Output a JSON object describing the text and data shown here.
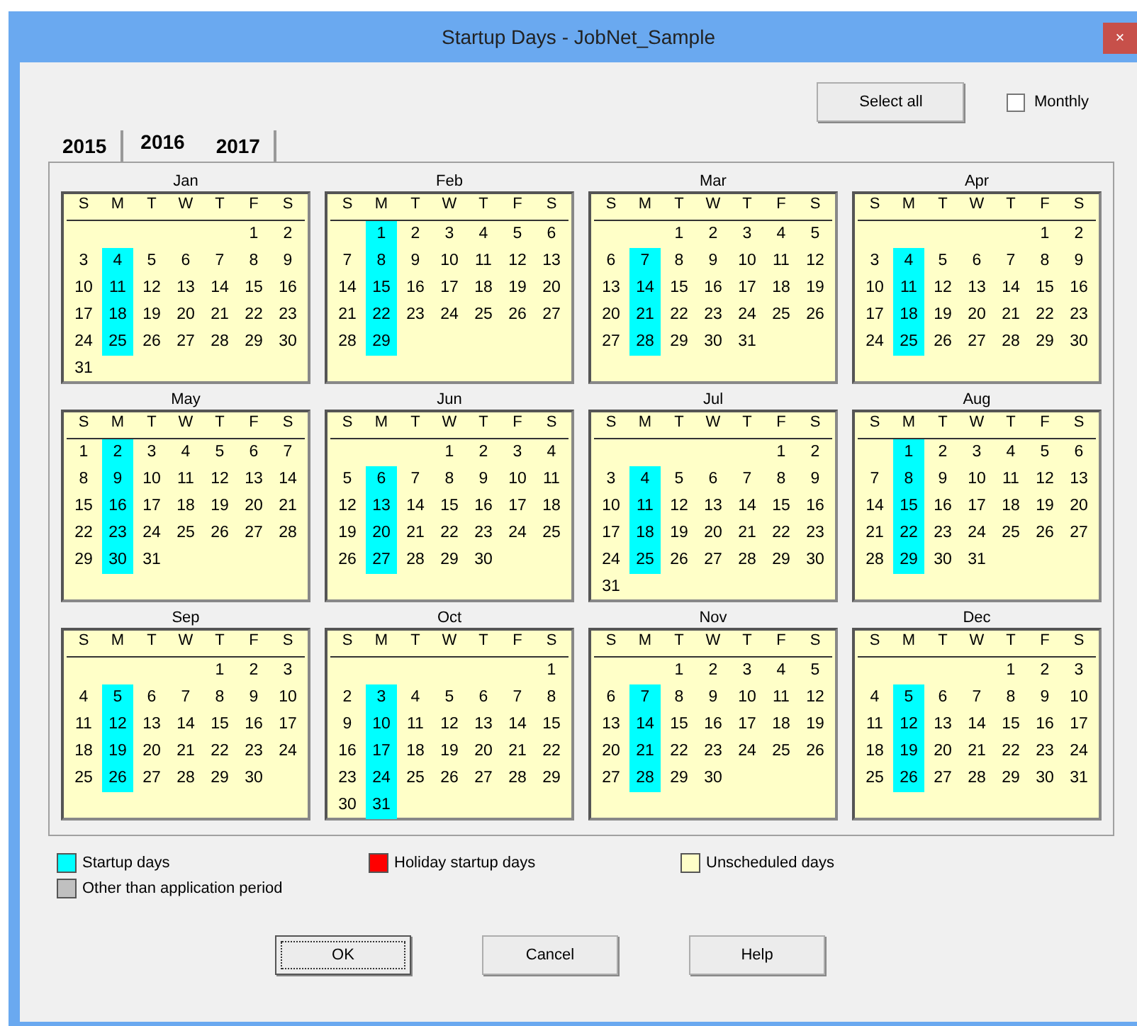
{
  "window": {
    "title": "Startup Days - JobNet_Sample",
    "close": "×"
  },
  "select_all": "Select all",
  "monthly": {
    "label": "Monthly",
    "checked": false
  },
  "tabs": [
    {
      "label": "2015",
      "selected": false
    },
    {
      "label": "2016",
      "selected": true
    },
    {
      "label": "2017",
      "selected": false
    }
  ],
  "months": [
    {
      "name": "Jan",
      "weekdays": [
        "S",
        "M",
        "T",
        "W",
        "T",
        "F",
        "S"
      ],
      "weeks": [
        [
          {
            "d": "1",
            "s": false
          },
          {
            "d": "2",
            "s": false
          }
        ],
        [
          {
            "d": "3",
            "s": false
          },
          {
            "d": "4",
            "s": true
          },
          {
            "d": "5",
            "s": false
          },
          {
            "d": "6",
            "s": false
          },
          {
            "d": "7",
            "s": false
          },
          {
            "d": "8",
            "s": false
          },
          {
            "d": "9",
            "s": false
          }
        ],
        [
          {
            "d": "10",
            "s": false
          },
          {
            "d": "11",
            "s": true
          },
          {
            "d": "12",
            "s": false
          },
          {
            "d": "13",
            "s": false
          },
          {
            "d": "14",
            "s": false
          },
          {
            "d": "15",
            "s": false
          },
          {
            "d": "16",
            "s": false
          }
        ],
        [
          {
            "d": "17",
            "s": false
          },
          {
            "d": "18",
            "s": true
          },
          {
            "d": "19",
            "s": false
          },
          {
            "d": "20",
            "s": false
          },
          {
            "d": "21",
            "s": false
          },
          {
            "d": "22",
            "s": false
          },
          {
            "d": "23",
            "s": false
          }
        ],
        [
          {
            "d": "24",
            "s": false
          },
          {
            "d": "25",
            "s": true
          },
          {
            "d": "26",
            "s": false
          },
          {
            "d": "27",
            "s": false
          },
          {
            "d": "28",
            "s": false
          },
          {
            "d": "29",
            "s": false
          },
          {
            "d": "30",
            "s": false
          }
        ],
        [
          {
            "d": "31",
            "s": false
          }
        ]
      ]
    },
    {
      "name": "Feb",
      "weekdays": [
        "S",
        "M",
        "T",
        "W",
        "T",
        "F",
        "S"
      ],
      "weeks": [
        [
          {
            "d": "1",
            "s": true
          },
          {
            "d": "2",
            "s": false
          },
          {
            "d": "3",
            "s": false
          },
          {
            "d": "4",
            "s": false
          },
          {
            "d": "5",
            "s": false
          },
          {
            "d": "6",
            "s": false
          }
        ],
        [
          {
            "d": "7",
            "s": false
          },
          {
            "d": "8",
            "s": true
          },
          {
            "d": "9",
            "s": false
          },
          {
            "d": "10",
            "s": false
          },
          {
            "d": "11",
            "s": false
          },
          {
            "d": "12",
            "s": false
          },
          {
            "d": "13",
            "s": false
          }
        ],
        [
          {
            "d": "14",
            "s": false
          },
          {
            "d": "15",
            "s": true
          },
          {
            "d": "16",
            "s": false
          },
          {
            "d": "17",
            "s": false
          },
          {
            "d": "18",
            "s": false
          },
          {
            "d": "19",
            "s": false
          },
          {
            "d": "20",
            "s": false
          }
        ],
        [
          {
            "d": "21",
            "s": false
          },
          {
            "d": "22",
            "s": true
          },
          {
            "d": "23",
            "s": false
          },
          {
            "d": "24",
            "s": false
          },
          {
            "d": "25",
            "s": false
          },
          {
            "d": "26",
            "s": false
          },
          {
            "d": "27",
            "s": false
          }
        ],
        [
          {
            "d": "28",
            "s": false
          },
          {
            "d": "29",
            "s": true
          }
        ]
      ]
    },
    {
      "name": "Mar",
      "weekdays": [
        "S",
        "M",
        "T",
        "W",
        "T",
        "F",
        "S"
      ],
      "weeks": [
        [
          {
            "d": "1",
            "s": false
          },
          {
            "d": "2",
            "s": false
          },
          {
            "d": "3",
            "s": false
          },
          {
            "d": "4",
            "s": false
          },
          {
            "d": "5",
            "s": false
          }
        ],
        [
          {
            "d": "6",
            "s": false
          },
          {
            "d": "7",
            "s": true
          },
          {
            "d": "8",
            "s": false
          },
          {
            "d": "9",
            "s": false
          },
          {
            "d": "10",
            "s": false
          },
          {
            "d": "11",
            "s": false
          },
          {
            "d": "12",
            "s": false
          }
        ],
        [
          {
            "d": "13",
            "s": false
          },
          {
            "d": "14",
            "s": true
          },
          {
            "d": "15",
            "s": false
          },
          {
            "d": "16",
            "s": false
          },
          {
            "d": "17",
            "s": false
          },
          {
            "d": "18",
            "s": false
          },
          {
            "d": "19",
            "s": false
          }
        ],
        [
          {
            "d": "20",
            "s": false
          },
          {
            "d": "21",
            "s": true
          },
          {
            "d": "22",
            "s": false
          },
          {
            "d": "23",
            "s": false
          },
          {
            "d": "24",
            "s": false
          },
          {
            "d": "25",
            "s": false
          },
          {
            "d": "26",
            "s": false
          }
        ],
        [
          {
            "d": "27",
            "s": false
          },
          {
            "d": "28",
            "s": true
          },
          {
            "d": "29",
            "s": false
          },
          {
            "d": "30",
            "s": false
          },
          {
            "d": "31",
            "s": false
          }
        ]
      ]
    },
    {
      "name": "Apr",
      "weekdays": [
        "S",
        "M",
        "T",
        "W",
        "T",
        "F",
        "S"
      ],
      "weeks": [
        [
          {
            "d": "1",
            "s": false
          },
          {
            "d": "2",
            "s": false
          }
        ],
        [
          {
            "d": "3",
            "s": false
          },
          {
            "d": "4",
            "s": true
          },
          {
            "d": "5",
            "s": false
          },
          {
            "d": "6",
            "s": false
          },
          {
            "d": "7",
            "s": false
          },
          {
            "d": "8",
            "s": false
          },
          {
            "d": "9",
            "s": false
          }
        ],
        [
          {
            "d": "10",
            "s": false
          },
          {
            "d": "11",
            "s": true
          },
          {
            "d": "12",
            "s": false
          },
          {
            "d": "13",
            "s": false
          },
          {
            "d": "14",
            "s": false
          },
          {
            "d": "15",
            "s": false
          },
          {
            "d": "16",
            "s": false
          }
        ],
        [
          {
            "d": "17",
            "s": false
          },
          {
            "d": "18",
            "s": true
          },
          {
            "d": "19",
            "s": false
          },
          {
            "d": "20",
            "s": false
          },
          {
            "d": "21",
            "s": false
          },
          {
            "d": "22",
            "s": false
          },
          {
            "d": "23",
            "s": false
          }
        ],
        [
          {
            "d": "24",
            "s": false
          },
          {
            "d": "25",
            "s": true
          },
          {
            "d": "26",
            "s": false
          },
          {
            "d": "27",
            "s": false
          },
          {
            "d": "28",
            "s": false
          },
          {
            "d": "29",
            "s": false
          },
          {
            "d": "30",
            "s": false
          }
        ]
      ]
    },
    {
      "name": "May",
      "weekdays": [
        "S",
        "M",
        "T",
        "W",
        "T",
        "F",
        "S"
      ],
      "weeks": [
        [
          {
            "d": "1",
            "s": false
          },
          {
            "d": "2",
            "s": true
          },
          {
            "d": "3",
            "s": false
          },
          {
            "d": "4",
            "s": false
          },
          {
            "d": "5",
            "s": false
          },
          {
            "d": "6",
            "s": false
          },
          {
            "d": "7",
            "s": false
          }
        ],
        [
          {
            "d": "8",
            "s": false
          },
          {
            "d": "9",
            "s": true
          },
          {
            "d": "10",
            "s": false
          },
          {
            "d": "11",
            "s": false
          },
          {
            "d": "12",
            "s": false
          },
          {
            "d": "13",
            "s": false
          },
          {
            "d": "14",
            "s": false
          }
        ],
        [
          {
            "d": "15",
            "s": false
          },
          {
            "d": "16",
            "s": true
          },
          {
            "d": "17",
            "s": false
          },
          {
            "d": "18",
            "s": false
          },
          {
            "d": "19",
            "s": false
          },
          {
            "d": "20",
            "s": false
          },
          {
            "d": "21",
            "s": false
          }
        ],
        [
          {
            "d": "22",
            "s": false
          },
          {
            "d": "23",
            "s": true
          },
          {
            "d": "24",
            "s": false
          },
          {
            "d": "25",
            "s": false
          },
          {
            "d": "26",
            "s": false
          },
          {
            "d": "27",
            "s": false
          },
          {
            "d": "28",
            "s": false
          }
        ],
        [
          {
            "d": "29",
            "s": false
          },
          {
            "d": "30",
            "s": true
          },
          {
            "d": "31",
            "s": false
          }
        ]
      ]
    },
    {
      "name": "Jun",
      "weekdays": [
        "S",
        "M",
        "T",
        "W",
        "T",
        "F",
        "S"
      ],
      "weeks": [
        [
          {
            "d": "1",
            "s": false
          },
          {
            "d": "2",
            "s": false
          },
          {
            "d": "3",
            "s": false
          },
          {
            "d": "4",
            "s": false
          }
        ],
        [
          {
            "d": "5",
            "s": false
          },
          {
            "d": "6",
            "s": true
          },
          {
            "d": "7",
            "s": false
          },
          {
            "d": "8",
            "s": false
          },
          {
            "d": "9",
            "s": false
          },
          {
            "d": "10",
            "s": false
          },
          {
            "d": "11",
            "s": false
          }
        ],
        [
          {
            "d": "12",
            "s": false
          },
          {
            "d": "13",
            "s": true
          },
          {
            "d": "14",
            "s": false
          },
          {
            "d": "15",
            "s": false
          },
          {
            "d": "16",
            "s": false
          },
          {
            "d": "17",
            "s": false
          },
          {
            "d": "18",
            "s": false
          }
        ],
        [
          {
            "d": "19",
            "s": false
          },
          {
            "d": "20",
            "s": true
          },
          {
            "d": "21",
            "s": false
          },
          {
            "d": "22",
            "s": false
          },
          {
            "d": "23",
            "s": false
          },
          {
            "d": "24",
            "s": false
          },
          {
            "d": "25",
            "s": false
          }
        ],
        [
          {
            "d": "26",
            "s": false
          },
          {
            "d": "27",
            "s": true
          },
          {
            "d": "28",
            "s": false
          },
          {
            "d": "29",
            "s": false
          },
          {
            "d": "30",
            "s": false
          }
        ]
      ]
    },
    {
      "name": "Jul",
      "weekdays": [
        "S",
        "M",
        "T",
        "W",
        "T",
        "F",
        "S"
      ],
      "weeks": [
        [
          {
            "d": "1",
            "s": false
          },
          {
            "d": "2",
            "s": false
          }
        ],
        [
          {
            "d": "3",
            "s": false
          },
          {
            "d": "4",
            "s": true
          },
          {
            "d": "5",
            "s": false
          },
          {
            "d": "6",
            "s": false
          },
          {
            "d": "7",
            "s": false
          },
          {
            "d": "8",
            "s": false
          },
          {
            "d": "9",
            "s": false
          }
        ],
        [
          {
            "d": "10",
            "s": false
          },
          {
            "d": "11",
            "s": true
          },
          {
            "d": "12",
            "s": false
          },
          {
            "d": "13",
            "s": false
          },
          {
            "d": "14",
            "s": false
          },
          {
            "d": "15",
            "s": false
          },
          {
            "d": "16",
            "s": false
          }
        ],
        [
          {
            "d": "17",
            "s": false
          },
          {
            "d": "18",
            "s": true
          },
          {
            "d": "19",
            "s": false
          },
          {
            "d": "20",
            "s": false
          },
          {
            "d": "21",
            "s": false
          },
          {
            "d": "22",
            "s": false
          },
          {
            "d": "23",
            "s": false
          }
        ],
        [
          {
            "d": "24",
            "s": false
          },
          {
            "d": "25",
            "s": true
          },
          {
            "d": "26",
            "s": false
          },
          {
            "d": "27",
            "s": false
          },
          {
            "d": "28",
            "s": false
          },
          {
            "d": "29",
            "s": false
          },
          {
            "d": "30",
            "s": false
          }
        ],
        [
          {
            "d": "31",
            "s": false
          }
        ]
      ]
    },
    {
      "name": "Aug",
      "weekdays": [
        "S",
        "M",
        "T",
        "W",
        "T",
        "F",
        "S"
      ],
      "weeks": [
        [
          {
            "d": "1",
            "s": true
          },
          {
            "d": "2",
            "s": false
          },
          {
            "d": "3",
            "s": false
          },
          {
            "d": "4",
            "s": false
          },
          {
            "d": "5",
            "s": false
          },
          {
            "d": "6",
            "s": false
          }
        ],
        [
          {
            "d": "7",
            "s": false
          },
          {
            "d": "8",
            "s": true
          },
          {
            "d": "9",
            "s": false
          },
          {
            "d": "10",
            "s": false
          },
          {
            "d": "11",
            "s": false
          },
          {
            "d": "12",
            "s": false
          },
          {
            "d": "13",
            "s": false
          }
        ],
        [
          {
            "d": "14",
            "s": false
          },
          {
            "d": "15",
            "s": true
          },
          {
            "d": "16",
            "s": false
          },
          {
            "d": "17",
            "s": false
          },
          {
            "d": "18",
            "s": false
          },
          {
            "d": "19",
            "s": false
          },
          {
            "d": "20",
            "s": false
          }
        ],
        [
          {
            "d": "21",
            "s": false
          },
          {
            "d": "22",
            "s": true
          },
          {
            "d": "23",
            "s": false
          },
          {
            "d": "24",
            "s": false
          },
          {
            "d": "25",
            "s": false
          },
          {
            "d": "26",
            "s": false
          },
          {
            "d": "27",
            "s": false
          }
        ],
        [
          {
            "d": "28",
            "s": false
          },
          {
            "d": "29",
            "s": true
          },
          {
            "d": "30",
            "s": false
          },
          {
            "d": "31",
            "s": false
          }
        ]
      ]
    },
    {
      "name": "Sep",
      "weekdays": [
        "S",
        "M",
        "T",
        "W",
        "T",
        "F",
        "S"
      ],
      "weeks": [
        [
          {
            "d": "1",
            "s": false
          },
          {
            "d": "2",
            "s": false
          },
          {
            "d": "3",
            "s": false
          }
        ],
        [
          {
            "d": "4",
            "s": false
          },
          {
            "d": "5",
            "s": true
          },
          {
            "d": "6",
            "s": false
          },
          {
            "d": "7",
            "s": false
          },
          {
            "d": "8",
            "s": false
          },
          {
            "d": "9",
            "s": false
          },
          {
            "d": "10",
            "s": false
          }
        ],
        [
          {
            "d": "11",
            "s": false
          },
          {
            "d": "12",
            "s": true
          },
          {
            "d": "13",
            "s": false
          },
          {
            "d": "14",
            "s": false
          },
          {
            "d": "15",
            "s": false
          },
          {
            "d": "16",
            "s": false
          },
          {
            "d": "17",
            "s": false
          }
        ],
        [
          {
            "d": "18",
            "s": false
          },
          {
            "d": "19",
            "s": true
          },
          {
            "d": "20",
            "s": false
          },
          {
            "d": "21",
            "s": false
          },
          {
            "d": "22",
            "s": false
          },
          {
            "d": "23",
            "s": false
          },
          {
            "d": "24",
            "s": false
          }
        ],
        [
          {
            "d": "25",
            "s": false
          },
          {
            "d": "26",
            "s": true
          },
          {
            "d": "27",
            "s": false
          },
          {
            "d": "28",
            "s": false
          },
          {
            "d": "29",
            "s": false
          },
          {
            "d": "30",
            "s": false
          }
        ]
      ]
    },
    {
      "name": "Oct",
      "weekdays": [
        "S",
        "M",
        "T",
        "W",
        "T",
        "F",
        "S"
      ],
      "weeks": [
        [
          {
            "d": "1",
            "s": false
          }
        ],
        [
          {
            "d": "2",
            "s": false
          },
          {
            "d": "3",
            "s": true
          },
          {
            "d": "4",
            "s": false
          },
          {
            "d": "5",
            "s": false
          },
          {
            "d": "6",
            "s": false
          },
          {
            "d": "7",
            "s": false
          },
          {
            "d": "8",
            "s": false
          }
        ],
        [
          {
            "d": "9",
            "s": false
          },
          {
            "d": "10",
            "s": true
          },
          {
            "d": "11",
            "s": false
          },
          {
            "d": "12",
            "s": false
          },
          {
            "d": "13",
            "s": false
          },
          {
            "d": "14",
            "s": false
          },
          {
            "d": "15",
            "s": false
          }
        ],
        [
          {
            "d": "16",
            "s": false
          },
          {
            "d": "17",
            "s": true
          },
          {
            "d": "18",
            "s": false
          },
          {
            "d": "19",
            "s": false
          },
          {
            "d": "20",
            "s": false
          },
          {
            "d": "21",
            "s": false
          },
          {
            "d": "22",
            "s": false
          }
        ],
        [
          {
            "d": "23",
            "s": false
          },
          {
            "d": "24",
            "s": true
          },
          {
            "d": "25",
            "s": false
          },
          {
            "d": "26",
            "s": false
          },
          {
            "d": "27",
            "s": false
          },
          {
            "d": "28",
            "s": false
          },
          {
            "d": "29",
            "s": false
          }
        ],
        [
          {
            "d": "30",
            "s": false
          },
          {
            "d": "31",
            "s": true
          }
        ]
      ]
    },
    {
      "name": "Nov",
      "weekdays": [
        "S",
        "M",
        "T",
        "W",
        "T",
        "F",
        "S"
      ],
      "weeks": [
        [
          {
            "d": "1",
            "s": false
          },
          {
            "d": "2",
            "s": false
          },
          {
            "d": "3",
            "s": false
          },
          {
            "d": "4",
            "s": false
          },
          {
            "d": "5",
            "s": false
          }
        ],
        [
          {
            "d": "6",
            "s": false
          },
          {
            "d": "7",
            "s": true
          },
          {
            "d": "8",
            "s": false
          },
          {
            "d": "9",
            "s": false
          },
          {
            "d": "10",
            "s": false
          },
          {
            "d": "11",
            "s": false
          },
          {
            "d": "12",
            "s": false
          }
        ],
        [
          {
            "d": "13",
            "s": false
          },
          {
            "d": "14",
            "s": true
          },
          {
            "d": "15",
            "s": false
          },
          {
            "d": "16",
            "s": false
          },
          {
            "d": "17",
            "s": false
          },
          {
            "d": "18",
            "s": false
          },
          {
            "d": "19",
            "s": false
          }
        ],
        [
          {
            "d": "20",
            "s": false
          },
          {
            "d": "21",
            "s": true
          },
          {
            "d": "22",
            "s": false
          },
          {
            "d": "23",
            "s": false
          },
          {
            "d": "24",
            "s": false
          },
          {
            "d": "25",
            "s": false
          },
          {
            "d": "26",
            "s": false
          }
        ],
        [
          {
            "d": "27",
            "s": false
          },
          {
            "d": "28",
            "s": true
          },
          {
            "d": "29",
            "s": false
          },
          {
            "d": "30",
            "s": false
          }
        ]
      ]
    },
    {
      "name": "Dec",
      "weekdays": [
        "S",
        "M",
        "T",
        "W",
        "T",
        "F",
        "S"
      ],
      "weeks": [
        [
          {
            "d": "1",
            "s": false
          },
          {
            "d": "2",
            "s": false
          },
          {
            "d": "3",
            "s": false
          }
        ],
        [
          {
            "d": "4",
            "s": false
          },
          {
            "d": "5",
            "s": true
          },
          {
            "d": "6",
            "s": false
          },
          {
            "d": "7",
            "s": false
          },
          {
            "d": "8",
            "s": false
          },
          {
            "d": "9",
            "s": false
          },
          {
            "d": "10",
            "s": false
          }
        ],
        [
          {
            "d": "11",
            "s": false
          },
          {
            "d": "12",
            "s": true
          },
          {
            "d": "13",
            "s": false
          },
          {
            "d": "14",
            "s": false
          },
          {
            "d": "15",
            "s": false
          },
          {
            "d": "16",
            "s": false
          },
          {
            "d": "17",
            "s": false
          }
        ],
        [
          {
            "d": "18",
            "s": false
          },
          {
            "d": "19",
            "s": true
          },
          {
            "d": "20",
            "s": false
          },
          {
            "d": "21",
            "s": false
          },
          {
            "d": "22",
            "s": false
          },
          {
            "d": "23",
            "s": false
          },
          {
            "d": "24",
            "s": false
          }
        ],
        [
          {
            "d": "25",
            "s": false
          },
          {
            "d": "26",
            "s": true
          },
          {
            "d": "27",
            "s": false
          },
          {
            "d": "28",
            "s": false
          },
          {
            "d": "29",
            "s": false
          },
          {
            "d": "30",
            "s": false
          },
          {
            "d": "31",
            "s": false
          }
        ]
      ]
    }
  ],
  "legend": [
    {
      "label": "Startup days",
      "color": "#00ffff"
    },
    {
      "label": "Holiday startup days",
      "color": "#ff0000"
    },
    {
      "label": "Unscheduled days",
      "color": "#ffffc8"
    },
    {
      "label": "Other than application period",
      "color": "#c0c0c0"
    }
  ],
  "buttons": [
    {
      "label": "OK",
      "default": true
    },
    {
      "label": "Cancel",
      "default": false
    },
    {
      "label": "Help",
      "default": false
    }
  ]
}
